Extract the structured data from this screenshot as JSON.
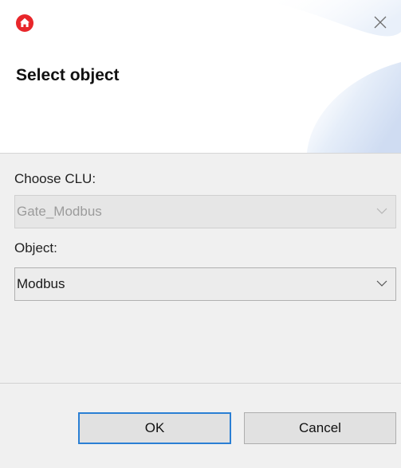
{
  "dialog": {
    "title": "Select object",
    "app_icon": "grenton-home-icon",
    "close_icon": "close-icon",
    "accent_color": "#e8262a"
  },
  "form": {
    "clu_label": "Choose CLU:",
    "clu_value": "Gate_Modbus",
    "object_label": "Object:",
    "object_value": "Modbus"
  },
  "buttons": {
    "ok_label": "OK",
    "cancel_label": "Cancel"
  }
}
